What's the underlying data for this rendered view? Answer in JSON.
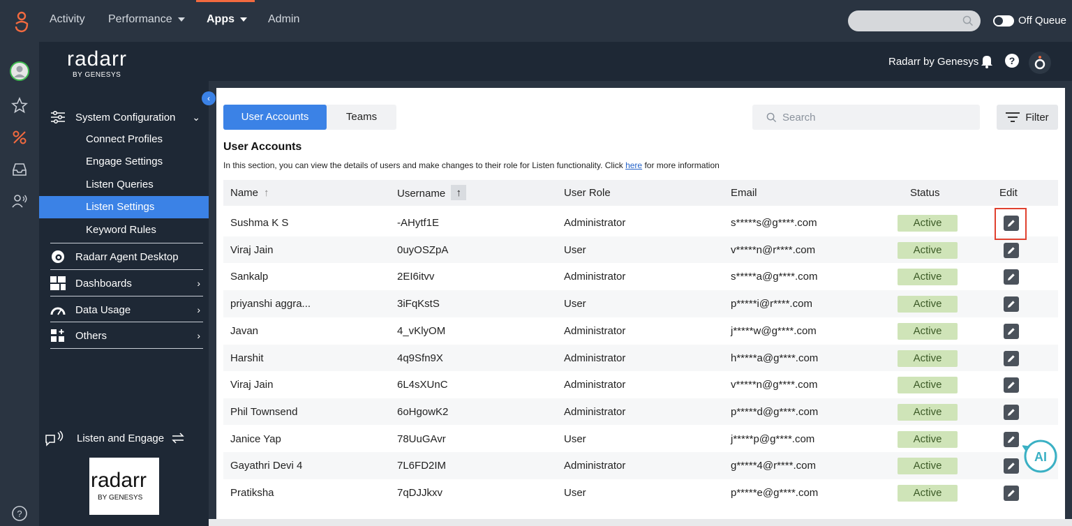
{
  "topnav": {
    "items": [
      {
        "label": "Activity"
      },
      {
        "label": "Performance"
      },
      {
        "label": "Apps"
      },
      {
        "label": "Admin"
      }
    ],
    "queue_label": "Off Queue"
  },
  "brand": {
    "word": "radarr",
    "by": "BY GENESYS"
  },
  "sidebar": {
    "system_configuration": "System Configuration",
    "sub_items": [
      "Connect Profiles",
      "Engage Settings",
      "Listen Queries",
      "Listen Settings",
      "Keyword Rules"
    ],
    "agent_desktop": "Radarr Agent Desktop",
    "dashboards": "Dashboards",
    "data_usage": "Data Usage",
    "others": "Others",
    "listen_engage": "Listen and Engage"
  },
  "header": {
    "title": "Radarr by Genesys"
  },
  "tabs": {
    "user_accounts": "User Accounts",
    "teams": "Teams"
  },
  "search": {
    "placeholder": "Search"
  },
  "filter": {
    "label": "Filter"
  },
  "section": {
    "title": "User Accounts",
    "desc_before": "In this section, you can view the details of users and make changes to their role for Listen functionality. Click ",
    "desc_link": "here",
    "desc_after": " for more information"
  },
  "table": {
    "columns": {
      "name": "Name",
      "username": "Username",
      "role": "User Role",
      "email": "Email",
      "status": "Status",
      "edit": "Edit"
    },
    "rows": [
      {
        "name": "Sushma K S",
        "username": "-AHytf1E",
        "role": "Administrator",
        "email": "s*****s@g****.com",
        "status": "Active"
      },
      {
        "name": "Viraj Jain",
        "username": "0uyOSZpA",
        "role": "User",
        "email": "v*****n@r****.com",
        "status": "Active"
      },
      {
        "name": "Sankalp",
        "username": "2EI6itvv",
        "role": "Administrator",
        "email": "s*****a@g****.com",
        "status": "Active"
      },
      {
        "name": "priyanshi aggra...",
        "username": "3iFqKstS",
        "role": "User",
        "email": "p*****i@r****.com",
        "status": "Active"
      },
      {
        "name": "Javan",
        "username": "4_vKlyOM",
        "role": "Administrator",
        "email": "j*****w@g****.com",
        "status": "Active"
      },
      {
        "name": "Harshit",
        "username": "4q9Sfn9X",
        "role": "Administrator",
        "email": "h*****a@g****.com",
        "status": "Active"
      },
      {
        "name": "Viraj Jain",
        "username": "6L4sXUnC",
        "role": "Administrator",
        "email": "v*****n@g****.com",
        "status": "Active"
      },
      {
        "name": "Phil Townsend",
        "username": "6oHgowK2",
        "role": "Administrator",
        "email": "p*****d@g****.com",
        "status": "Active"
      },
      {
        "name": "Janice Yap",
        "username": "78UuGAvr",
        "role": "User",
        "email": "j*****p@g****.com",
        "status": "Active"
      },
      {
        "name": "Gayathri Devi 4",
        "username": "7L6FD2IM",
        "role": "Administrator",
        "email": "g*****4@r****.com",
        "status": "Active"
      },
      {
        "name": "Pratiksha",
        "username": "7qDJJkxv",
        "role": "User",
        "email": "p*****e@g****.com",
        "status": "Active"
      }
    ]
  },
  "colors": {
    "accent": "#3b82e6",
    "nav_bg": "#2a3441",
    "status_bg": "#cfe4b8",
    "highlight": "#e0412f"
  }
}
